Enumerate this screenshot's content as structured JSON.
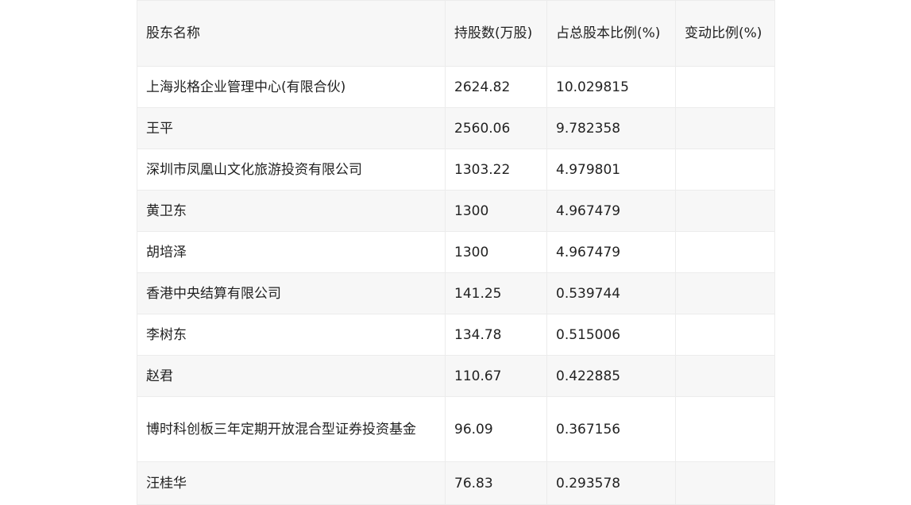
{
  "table": {
    "headers": [
      "股东名称",
      "持股数(万股)",
      "占总股本比例(%)",
      "变动比例(%)"
    ],
    "rows": [
      [
        "上海兆格企业管理中心(有限合伙)",
        "2624.82",
        "10.029815",
        ""
      ],
      [
        "王平",
        "2560.06",
        "9.782358",
        ""
      ],
      [
        "深圳市凤凰山文化旅游投资有限公司",
        "1303.22",
        "4.979801",
        ""
      ],
      [
        "黄卫东",
        "1300",
        "4.967479",
        ""
      ],
      [
        "胡培泽",
        "1300",
        "4.967479",
        ""
      ],
      [
        "香港中央结算有限公司",
        "141.25",
        "0.539744",
        ""
      ],
      [
        "李树东",
        "134.78",
        "0.515006",
        ""
      ],
      [
        "赵君",
        "110.67",
        "0.422885",
        ""
      ],
      [
        "博时科创板三年定期开放混合型证券投资基金",
        "96.09",
        "0.367156",
        ""
      ],
      [
        "汪桂华",
        "76.83",
        "0.293578",
        ""
      ]
    ]
  }
}
